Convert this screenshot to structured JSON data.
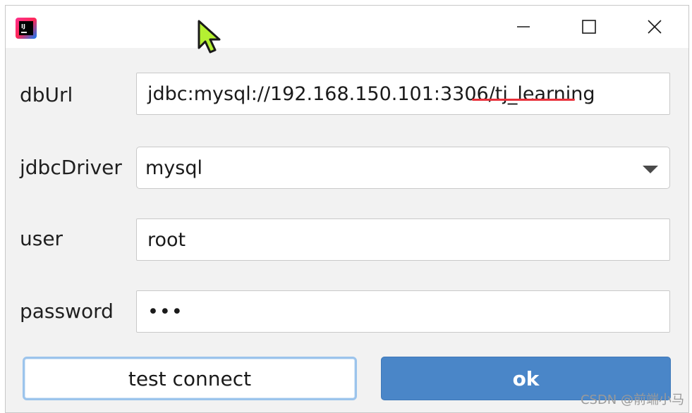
{
  "titlebar": {
    "app_icon": "intellij-idea-icon",
    "app_icon_text": "IJ",
    "minimize_icon": "minimize-icon",
    "maximize_icon": "maximize-icon",
    "close_icon": "close-icon"
  },
  "form": {
    "dburl_label": "dbUrl",
    "dburl_value": "jdbc:mysql://192.168.150.101:3306/tj_learning",
    "jdbc_driver_label": "jdbcDriver",
    "jdbc_driver_value": "mysql",
    "user_label": "user",
    "user_value": "root",
    "password_label": "password",
    "password_value": "•••"
  },
  "buttons": {
    "test_connect": "test connect",
    "ok": "ok"
  },
  "watermark": "CSDN @前端小马",
  "colors": {
    "ok_button_bg": "#4a86c8",
    "test_button_border": "#9cc4ec",
    "annotation_underline": "#e8303a",
    "cursor_fill": "#b5f032"
  }
}
